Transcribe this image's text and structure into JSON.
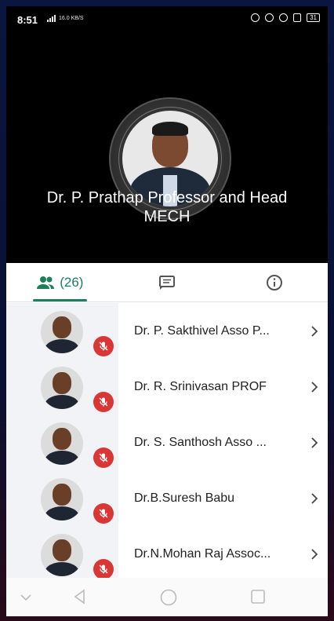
{
  "status": {
    "time": "8:51",
    "net_speed": "16.0 KB/S",
    "battery": "31"
  },
  "presenter": {
    "line1": "Dr. P. Prathap Professor and Head",
    "line2": "MECH"
  },
  "tabs": [
    {
      "icon": "people-icon",
      "label": "(26)"
    },
    {
      "icon": "chat-icon",
      "label": ""
    },
    {
      "icon": "info-icon",
      "label": ""
    }
  ],
  "participants": [
    {
      "name": "Dr. P. Sakthivel Asso P...",
      "muted": true
    },
    {
      "name": "Dr. R. Srinivasan PROF",
      "muted": true
    },
    {
      "name": "Dr. S. Santhosh Asso ...",
      "muted": true
    },
    {
      "name": "Dr.B.Suresh Babu",
      "muted": true
    },
    {
      "name": "Dr.N.Mohan Raj Assoc...",
      "muted": true
    }
  ],
  "colors": {
    "accent": "#1a7f5a",
    "mute": "#d93636"
  }
}
